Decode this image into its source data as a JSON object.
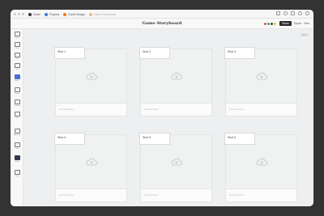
{
  "titlebar": {
    "tabs": [
      {
        "label": "Home",
        "color": "#333333",
        "icon": "home-icon"
      },
      {
        "label": "Projects",
        "color": "#3a7bd5",
        "icon": "folder-icon"
      },
      {
        "label": "Game Design",
        "color": "#e67e22",
        "icon": "document-icon"
      },
      {
        "label": "Game Storyboard",
        "color": "#e8c07a",
        "icon": "document-icon"
      }
    ]
  },
  "toolbar": {
    "title": "Game Storyboard",
    "share_label": "Share",
    "export_label": "Export",
    "view_label": "View"
  },
  "collaborators": [
    "#e74c3c",
    "#27ae60",
    "#2c3e50",
    "#f1c40f"
  ],
  "sidebar": {
    "tools": [
      {
        "label": "Board",
        "icon": "board-icon"
      },
      {
        "label": "Link",
        "icon": "link-icon"
      },
      {
        "label": "To-do",
        "icon": "todo-icon"
      },
      {
        "label": "Line",
        "icon": "line-icon"
      },
      {
        "label": "Board",
        "icon": "board-icon",
        "active": true
      },
      {
        "label": "Column",
        "icon": "column-icon"
      },
      {
        "label": "Comment",
        "icon": "comment-icon"
      },
      {
        "label": "Table",
        "icon": "table-icon"
      },
      {
        "label": "Add image",
        "icon": "image-icon"
      },
      {
        "label": "Draw",
        "icon": "pen-icon"
      },
      {
        "label": "Sketch",
        "icon": "sketch-icon",
        "dark": true
      },
      {
        "label": "Trash",
        "icon": "trash-icon"
      }
    ]
  },
  "canvas": {
    "zoom": "100%",
    "shots": [
      {
        "label": "Shot 1",
        "notes": "Add description"
      },
      {
        "label": "Shot 2",
        "notes": "Add description"
      },
      {
        "label": "Shot 3",
        "notes": "Add description"
      },
      {
        "label": "Shot 4",
        "notes": "Add description"
      },
      {
        "label": "Shot 5",
        "notes": "Add description"
      },
      {
        "label": "Shot 6",
        "notes": "Add description"
      }
    ]
  }
}
